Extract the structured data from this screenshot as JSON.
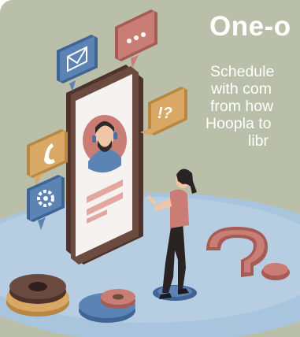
{
  "card": {
    "title": "One-o",
    "body_lines": [
      "Schedule",
      "with  com",
      "from how",
      "Hoopla to",
      "libr"
    ]
  },
  "colors": {
    "background": "#b9bfa8",
    "floor": "#a9c4dd",
    "phone": "#6b4a3f",
    "accent_rose": "#c97d74",
    "accent_blue": "#5b83b3",
    "accent_orange": "#d9a864",
    "text": "#ffffff"
  },
  "icons": [
    "mail-icon",
    "chat-dots-icon",
    "phone-call-icon",
    "question-exclaim-icon",
    "settings-gear-icon",
    "question-mark-icon",
    "cog-icon"
  ]
}
